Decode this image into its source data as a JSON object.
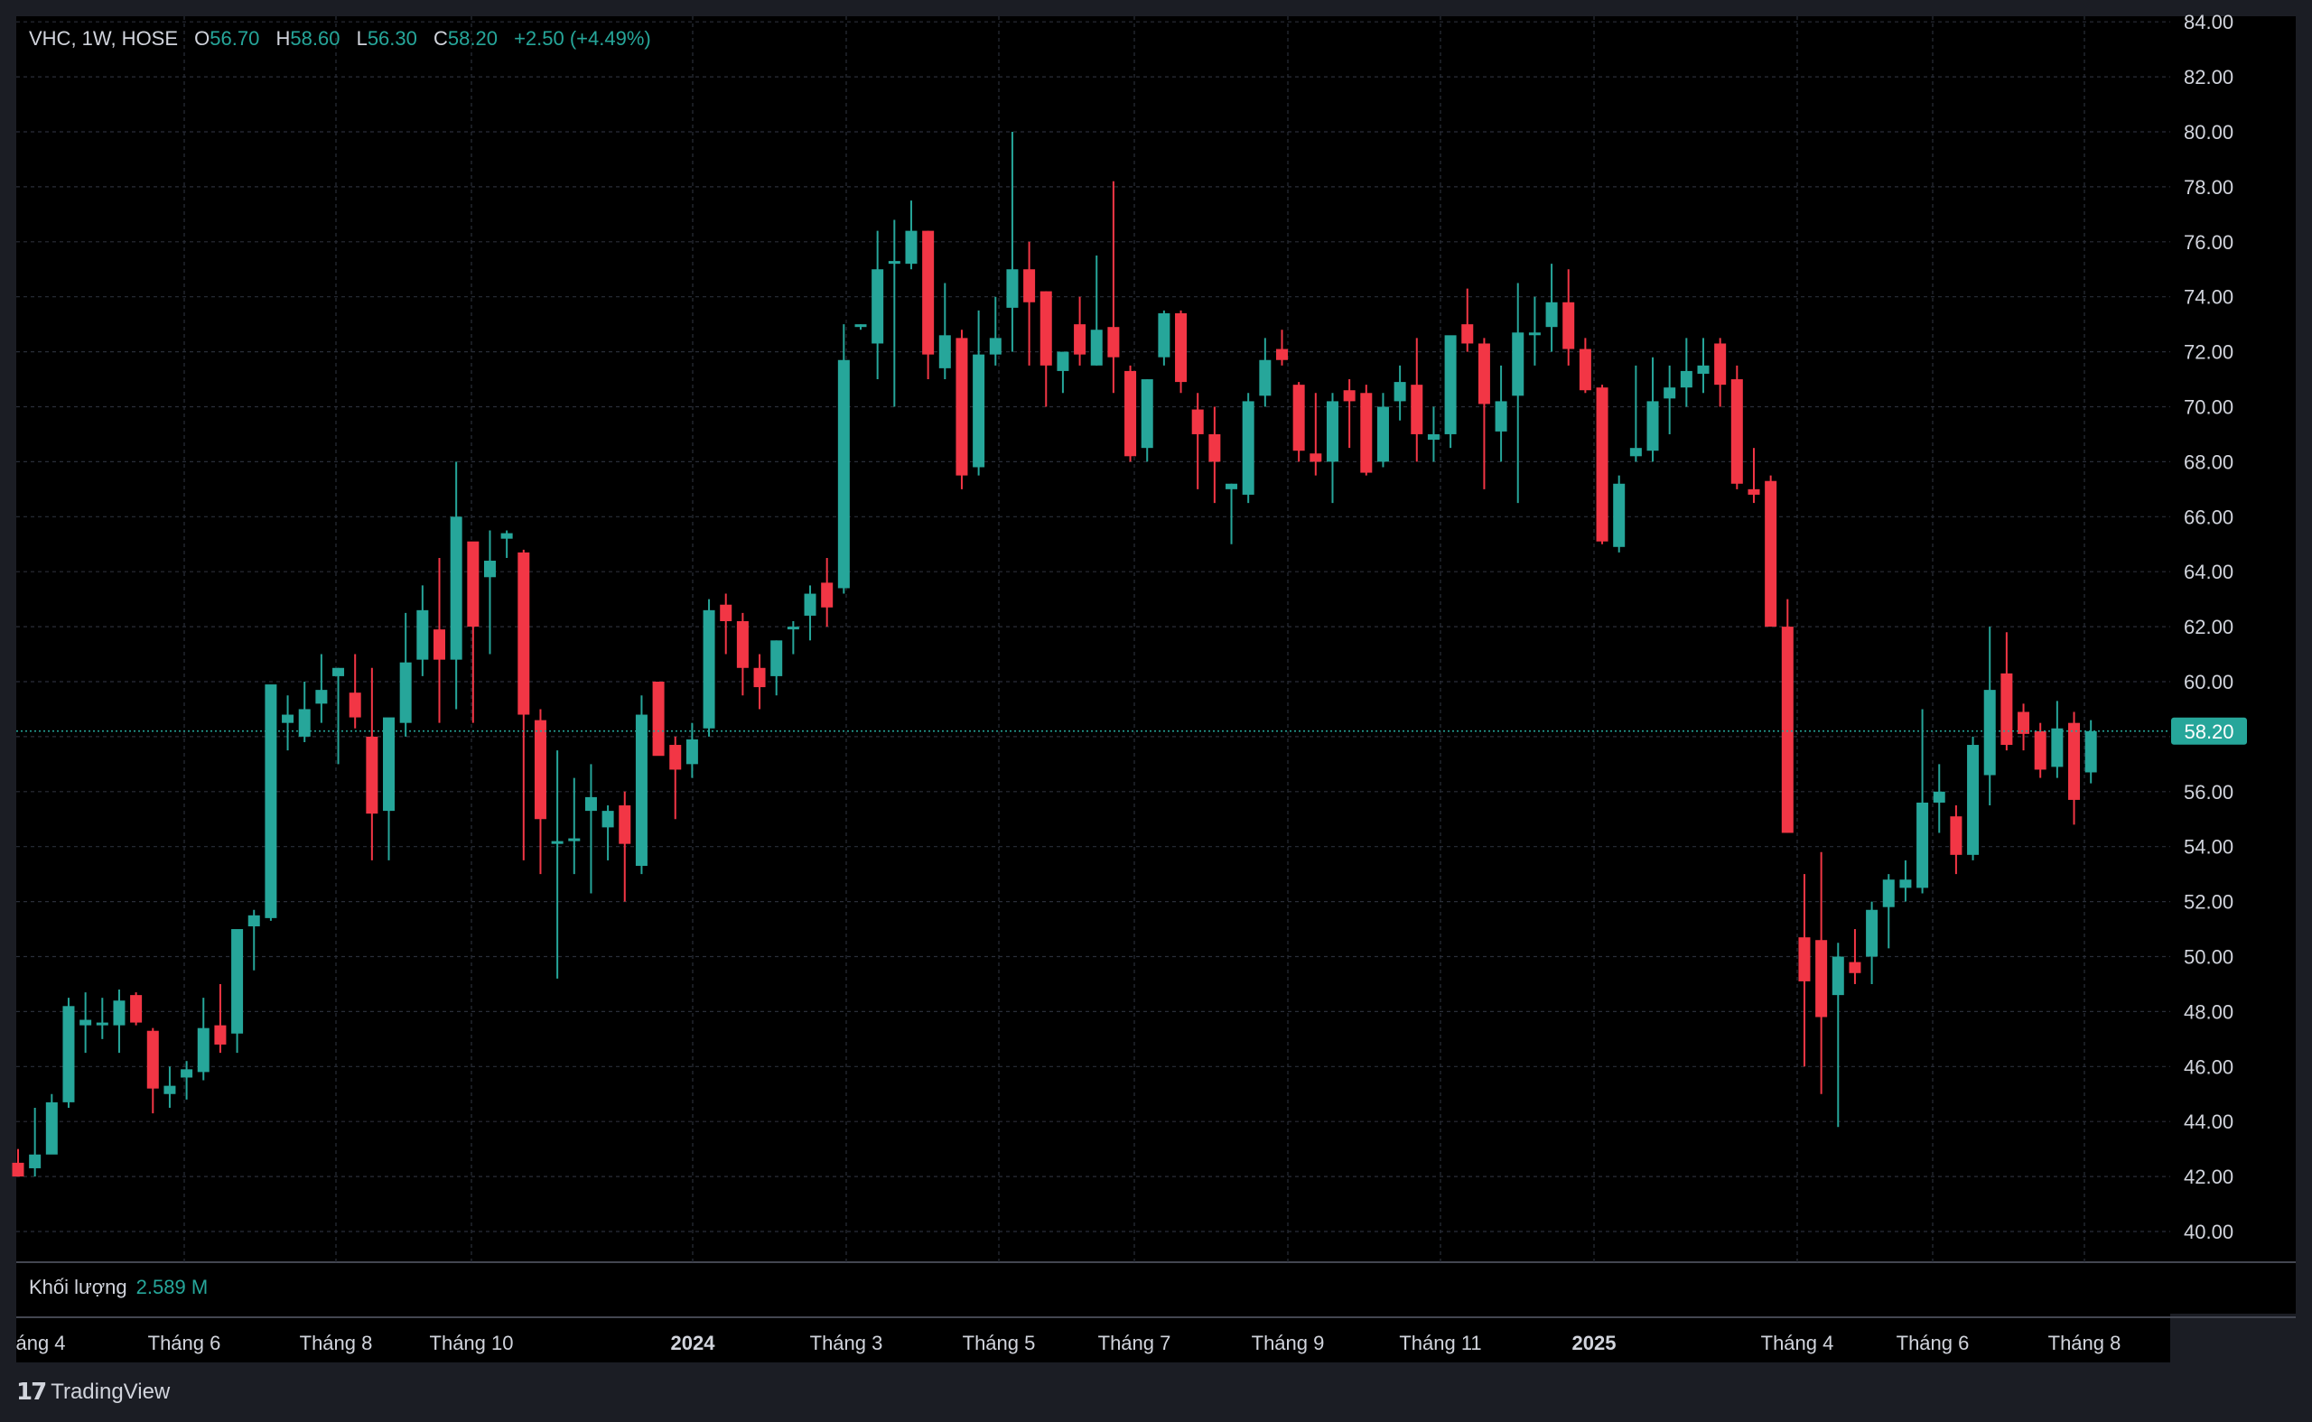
{
  "symbol": {
    "title": "VHC, 1W, HOSE",
    "open_label": "O",
    "open": "56.70",
    "high_label": "H",
    "high": "58.60",
    "low_label": "L",
    "low": "56.30",
    "close_label": "C",
    "close": "58.20",
    "change": "+2.50 (+4.49%)"
  },
  "volume": {
    "label": "Khối lượng",
    "value": "2.589 M"
  },
  "last_price_label": "58.20",
  "brand": {
    "name": "TradingView"
  },
  "colors": {
    "up": "#26a69a",
    "down": "#f23645",
    "background": "#000000",
    "grid": "#2a2e39",
    "price_badge": "#26a69a",
    "axis_text": "#d1d4dc"
  },
  "chart_data": {
    "type": "candlestick",
    "title": "",
    "ylim": [
      39,
      84.5
    ],
    "grid": true,
    "last_price": 58.2,
    "y_ticks": [
      "40.00",
      "42.00",
      "44.00",
      "46.00",
      "48.00",
      "50.00",
      "52.00",
      "54.00",
      "56.00",
      "58.00",
      "60.00",
      "62.00",
      "64.00",
      "66.00",
      "68.00",
      "70.00",
      "72.00",
      "74.00",
      "76.00",
      "78.00",
      "80.00",
      "82.00",
      "84.00"
    ],
    "x_ticks": [
      {
        "label": "áng 4",
        "bold": false
      },
      {
        "label": "Tháng 6",
        "bold": false
      },
      {
        "label": "Tháng 8",
        "bold": false
      },
      {
        "label": "Tháng 10",
        "bold": false
      },
      {
        "label": "2024",
        "bold": true
      },
      {
        "label": "Tháng 3",
        "bold": false
      },
      {
        "label": "Tháng 5",
        "bold": false
      },
      {
        "label": "Tháng 7",
        "bold": false
      },
      {
        "label": "Tháng 9",
        "bold": false
      },
      {
        "label": "Tháng 11",
        "bold": false
      },
      {
        "label": "2025",
        "bold": true
      },
      {
        "label": "Tháng 4",
        "bold": false
      },
      {
        "label": "Tháng 6",
        "bold": false
      },
      {
        "label": "Tháng 8",
        "bold": false
      }
    ],
    "candles": [
      [
        42.5,
        43.0,
        42.0,
        42.0
      ],
      [
        42.3,
        44.5,
        42.0,
        42.8
      ],
      [
        42.8,
        45.0,
        44.5,
        44.7
      ],
      [
        44.7,
        48.5,
        44.5,
        48.2
      ],
      [
        47.5,
        48.7,
        46.5,
        47.7
      ],
      [
        47.5,
        48.5,
        47.0,
        47.6
      ],
      [
        47.5,
        48.8,
        46.5,
        48.4
      ],
      [
        48.6,
        48.7,
        47.5,
        47.6
      ],
      [
        47.3,
        47.4,
        44.3,
        45.2
      ],
      [
        45.0,
        46.0,
        44.5,
        45.3
      ],
      [
        45.6,
        46.2,
        44.8,
        45.9
      ],
      [
        45.8,
        48.5,
        45.5,
        47.4
      ],
      [
        47.5,
        49.0,
        46.5,
        46.8
      ],
      [
        47.2,
        50.8,
        46.5,
        51.0
      ],
      [
        51.1,
        51.7,
        49.5,
        51.5
      ],
      [
        51.4,
        59.5,
        51.3,
        59.9
      ],
      [
        58.5,
        59.5,
        57.5,
        58.8
      ],
      [
        58.0,
        60.0,
        57.8,
        59.0
      ],
      [
        59.2,
        61.0,
        58.5,
        59.7
      ],
      [
        60.2,
        60.5,
        57.0,
        60.5
      ],
      [
        59.6,
        61.0,
        58.3,
        58.7
      ],
      [
        58.0,
        60.5,
        53.5,
        55.2
      ],
      [
        55.3,
        56.5,
        53.5,
        58.7
      ],
      [
        58.5,
        62.5,
        58.0,
        60.7
      ],
      [
        60.8,
        63.5,
        60.2,
        62.6
      ],
      [
        61.9,
        64.5,
        58.5,
        60.8
      ],
      [
        60.8,
        68.0,
        59.0,
        66.0
      ],
      [
        65.1,
        65.0,
        58.5,
        62.0
      ],
      [
        63.8,
        65.5,
        61.0,
        64.4
      ],
      [
        65.2,
        65.5,
        64.5,
        65.4
      ],
      [
        64.7,
        64.8,
        53.5,
        58.8
      ],
      [
        58.6,
        59.0,
        53.0,
        55.0
      ],
      [
        54.1,
        57.5,
        49.2,
        54.2
      ],
      [
        54.2,
        56.5,
        53.0,
        54.3
      ],
      [
        55.3,
        57.0,
        52.3,
        55.8
      ],
      [
        54.7,
        55.5,
        53.5,
        55.3
      ],
      [
        55.5,
        56.0,
        52.0,
        54.1
      ],
      [
        53.3,
        59.5,
        53.0,
        58.8
      ],
      [
        60.0,
        60.0,
        57.5,
        57.3
      ],
      [
        57.7,
        58.0,
        55.0,
        56.8
      ],
      [
        57.0,
        58.5,
        56.5,
        57.9
      ],
      [
        58.3,
        63.0,
        58.0,
        62.6
      ],
      [
        62.8,
        63.2,
        61.0,
        62.2
      ],
      [
        62.2,
        62.5,
        59.5,
        60.5
      ],
      [
        60.5,
        61.0,
        59.0,
        59.8
      ],
      [
        60.2,
        61.5,
        59.5,
        61.5
      ],
      [
        62.0,
        62.2,
        61.0,
        62.0
      ],
      [
        62.4,
        63.5,
        61.5,
        63.2
      ],
      [
        63.6,
        64.5,
        62.0,
        62.7
      ],
      [
        63.4,
        73.0,
        63.2,
        71.7
      ],
      [
        72.9,
        73.0,
        72.8,
        73.0
      ],
      [
        72.3,
        76.4,
        71.0,
        75.0
      ],
      [
        75.2,
        76.8,
        70.0,
        75.3
      ],
      [
        75.2,
        77.5,
        75.0,
        76.4
      ],
      [
        76.4,
        76.4,
        71.0,
        71.9
      ],
      [
        71.4,
        74.5,
        71.0,
        72.6
      ],
      [
        72.5,
        72.8,
        67.0,
        67.5
      ],
      [
        67.8,
        73.5,
        67.5,
        71.9
      ],
      [
        71.9,
        74.0,
        71.5,
        72.5
      ],
      [
        73.6,
        80.0,
        72.0,
        75.0
      ],
      [
        75.0,
        76.0,
        71.5,
        73.8
      ],
      [
        74.2,
        74.2,
        70.0,
        71.5
      ],
      [
        71.3,
        72.0,
        70.5,
        72.0
      ],
      [
        73.0,
        74.0,
        71.5,
        71.9
      ],
      [
        71.5,
        75.5,
        71.5,
        72.8
      ],
      [
        72.9,
        78.2,
        70.5,
        71.8
      ],
      [
        71.3,
        71.5,
        68.0,
        68.2
      ],
      [
        68.5,
        71.0,
        68.0,
        71.0
      ],
      [
        71.8,
        73.5,
        71.5,
        73.4
      ],
      [
        73.4,
        73.5,
        70.5,
        70.9
      ],
      [
        69.9,
        70.5,
        67.0,
        69.0
      ],
      [
        69.0,
        70.0,
        66.5,
        68.0
      ],
      [
        67.0,
        67.2,
        65.0,
        67.2
      ],
      [
        66.8,
        70.5,
        66.5,
        70.2
      ],
      [
        70.4,
        72.5,
        70.0,
        71.7
      ],
      [
        72.1,
        72.8,
        71.5,
        71.7
      ],
      [
        70.8,
        70.9,
        68.0,
        68.4
      ],
      [
        68.3,
        70.5,
        67.5,
        68.0
      ],
      [
        68.0,
        70.5,
        66.5,
        70.2
      ],
      [
        70.6,
        71.0,
        68.5,
        70.2
      ],
      [
        70.5,
        70.8,
        67.5,
        67.6
      ],
      [
        68.0,
        70.5,
        67.8,
        70.0
      ],
      [
        70.2,
        71.5,
        69.5,
        70.9
      ],
      [
        70.8,
        72.5,
        68.0,
        69.0
      ],
      [
        68.8,
        70.0,
        68.0,
        69.0
      ],
      [
        69.0,
        72.5,
        68.5,
        72.6
      ],
      [
        73.0,
        74.3,
        72.0,
        72.3
      ],
      [
        72.3,
        72.5,
        67.0,
        70.1
      ],
      [
        69.1,
        71.5,
        68.0,
        70.2
      ],
      [
        70.4,
        74.5,
        66.5,
        72.7
      ],
      [
        72.7,
        74.0,
        71.5,
        72.7
      ],
      [
        72.9,
        75.2,
        72.0,
        73.8
      ],
      [
        73.8,
        75.0,
        71.5,
        72.1
      ],
      [
        72.1,
        72.5,
        70.5,
        70.6
      ],
      [
        70.7,
        70.8,
        65.0,
        65.1
      ],
      [
        64.9,
        67.5,
        64.7,
        67.2
      ],
      [
        68.2,
        71.5,
        68.0,
        68.5
      ],
      [
        68.4,
        71.8,
        68.0,
        70.2
      ],
      [
        70.3,
        71.5,
        69.0,
        70.7
      ],
      [
        70.7,
        72.5,
        70.0,
        71.3
      ],
      [
        71.2,
        72.5,
        70.5,
        71.5
      ],
      [
        72.3,
        72.5,
        70.0,
        70.8
      ],
      [
        71.0,
        71.5,
        67.0,
        67.2
      ],
      [
        67.0,
        68.5,
        66.5,
        66.8
      ],
      [
        67.3,
        67.5,
        63.0,
        62.0
      ],
      [
        62.0,
        63.0,
        54.5,
        54.5
      ],
      [
        50.7,
        53.0,
        46.0,
        49.1
      ],
      [
        50.6,
        53.8,
        45.0,
        47.8
      ],
      [
        48.6,
        50.5,
        43.8,
        50.0
      ],
      [
        49.8,
        51.0,
        49.0,
        49.4
      ],
      [
        50.0,
        52.0,
        49.0,
        51.7
      ],
      [
        51.8,
        53.0,
        50.3,
        52.8
      ],
      [
        52.5,
        53.5,
        52.0,
        52.8
      ],
      [
        52.5,
        59.0,
        52.3,
        55.6
      ],
      [
        55.6,
        57.0,
        54.5,
        56.0
      ],
      [
        55.1,
        55.5,
        53.0,
        53.7
      ],
      [
        53.7,
        58.0,
        53.5,
        57.7
      ],
      [
        56.6,
        62.0,
        55.5,
        59.7
      ],
      [
        60.3,
        61.8,
        57.5,
        57.7
      ],
      [
        58.9,
        59.2,
        57.5,
        58.1
      ],
      [
        58.2,
        58.5,
        56.5,
        56.8
      ],
      [
        56.9,
        59.3,
        56.5,
        58.3
      ],
      [
        58.5,
        58.9,
        54.8,
        55.7
      ],
      [
        56.7,
        58.6,
        56.3,
        58.2
      ]
    ]
  }
}
